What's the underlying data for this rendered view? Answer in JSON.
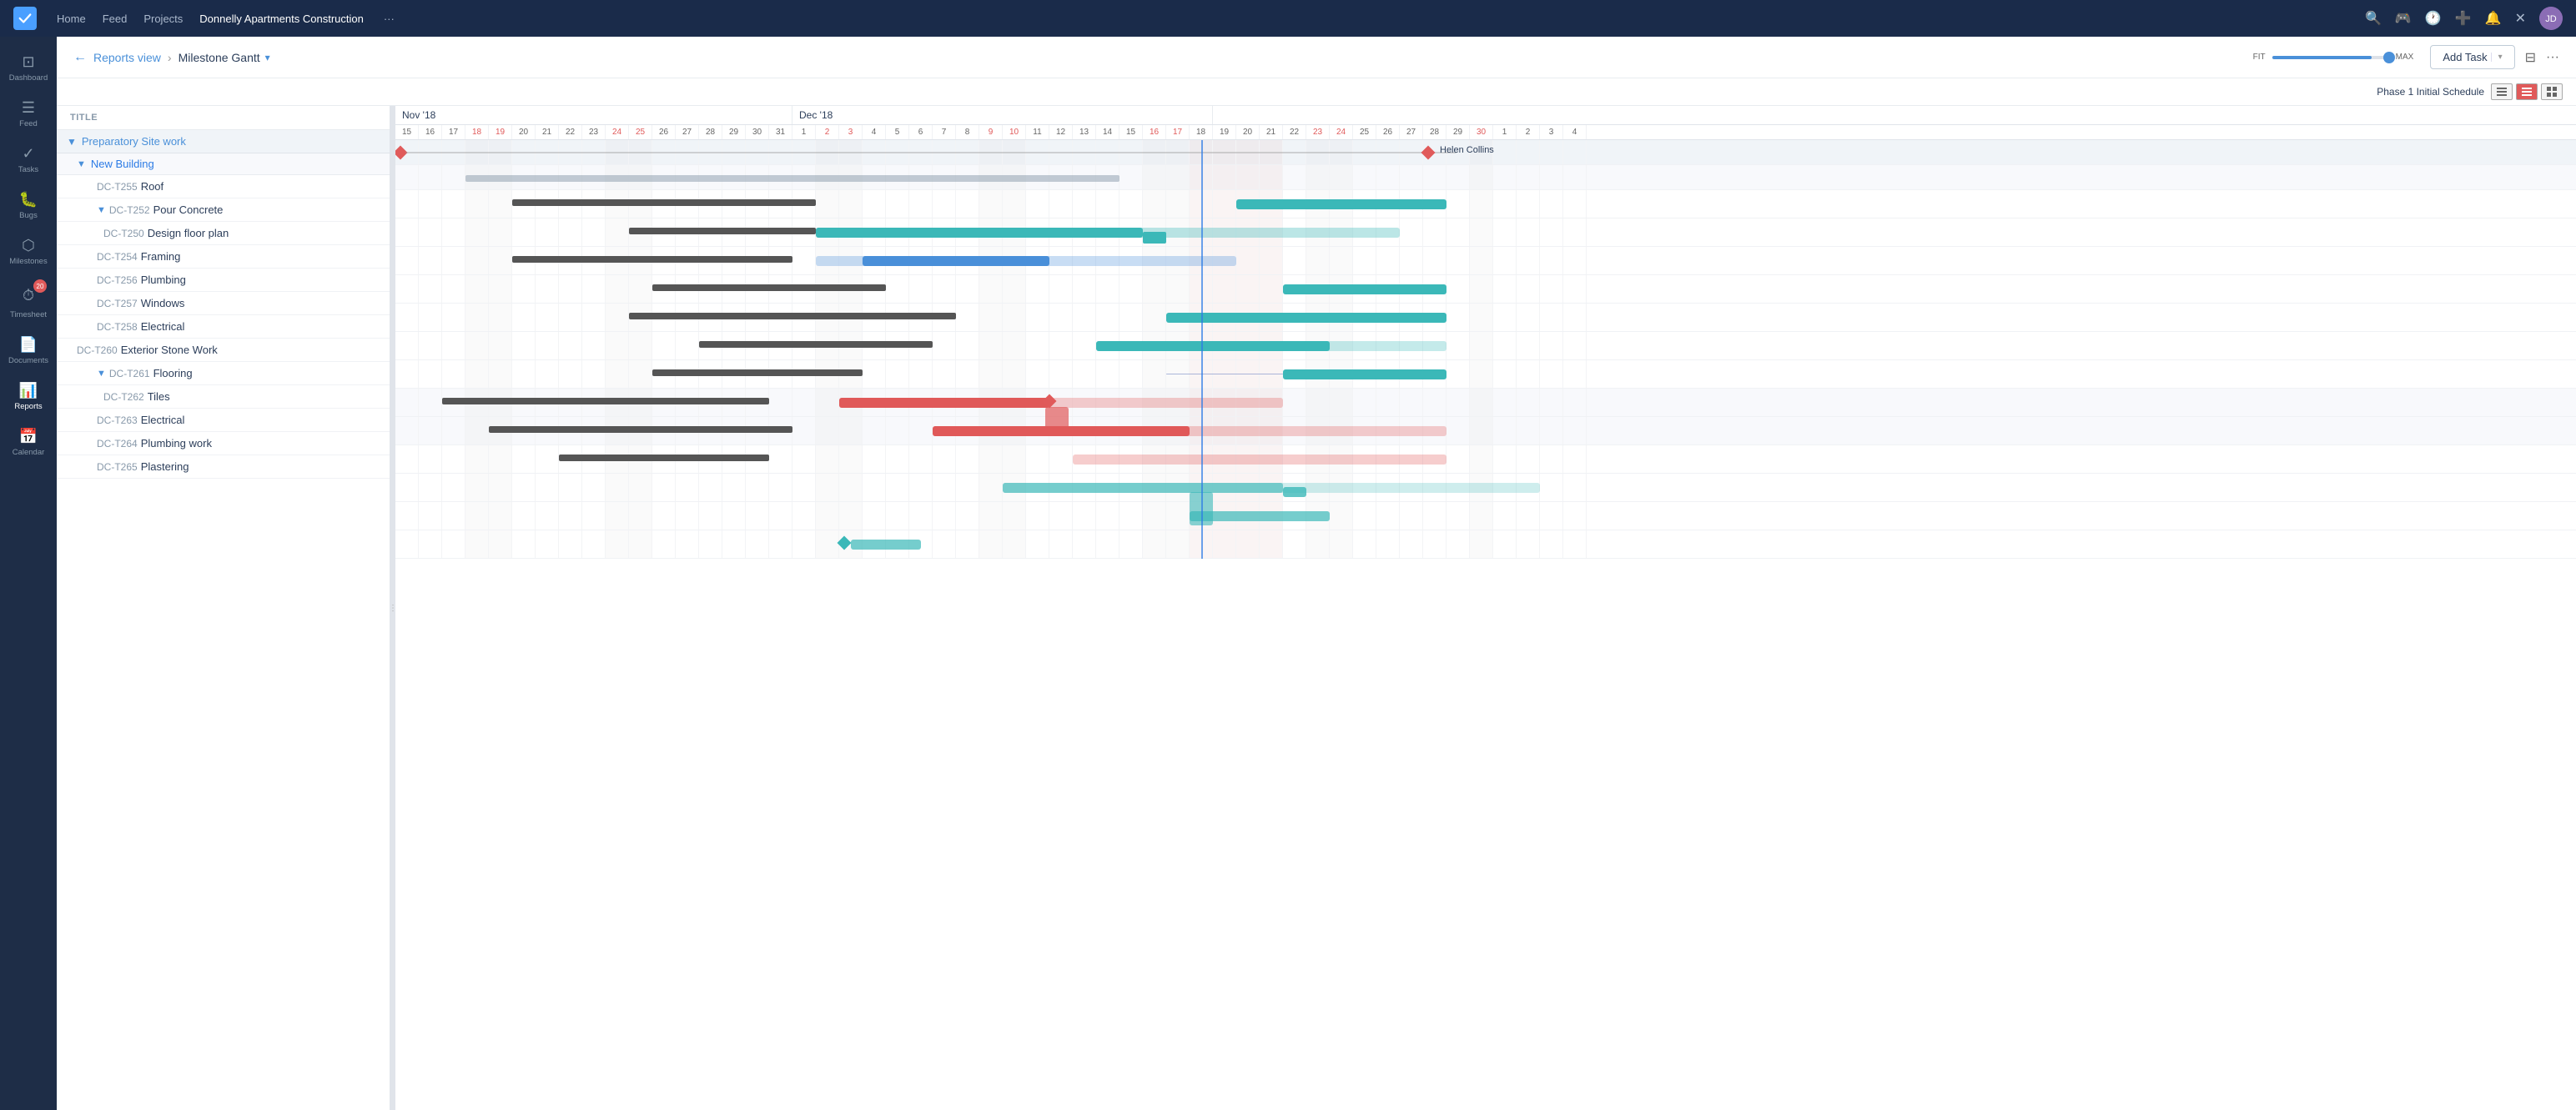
{
  "app": {
    "logo_text": "✓",
    "nav_links": [
      "Home",
      "Feed",
      "Projects"
    ],
    "project_name": "Donnelly Apartments Construction",
    "more_dots": "···"
  },
  "nav_right": {
    "search_icon": "🔍",
    "gamepad_icon": "🎮",
    "clock_icon": "🕐",
    "plus_icon": "➕",
    "bell_icon": "🔔",
    "close_icon": "✕"
  },
  "sidebar": {
    "items": [
      {
        "id": "dashboard",
        "label": "Dashboard",
        "icon": "⊡"
      },
      {
        "id": "feed",
        "label": "Feed",
        "icon": "☰"
      },
      {
        "id": "tasks",
        "label": "Tasks",
        "icon": "✓"
      },
      {
        "id": "bugs",
        "label": "Bugs",
        "icon": "🐛"
      },
      {
        "id": "milestones",
        "label": "Milestones",
        "icon": "⬡"
      },
      {
        "id": "timesheet",
        "label": "Timesheet",
        "icon": "⏱",
        "badge": "20"
      },
      {
        "id": "documents",
        "label": "Documents",
        "icon": "📄"
      },
      {
        "id": "reports",
        "label": "Reports",
        "icon": "📊",
        "active": true
      },
      {
        "id": "calendar",
        "label": "Calendar",
        "icon": "📅"
      }
    ]
  },
  "header": {
    "back_label": "←",
    "breadcrumb": "Reports view",
    "breadcrumb_sep": "›",
    "view_title": "Milestone Gantt",
    "dropdown_arrow": "▾",
    "fit_label": "FIT",
    "max_label": "MAX",
    "add_task_label": "Add Task",
    "filter_icon": "⊟",
    "more_icon": "···",
    "phase_label": "Phase 1 Initial Schedule"
  },
  "months": [
    {
      "label": "Nov '18",
      "span": 17
    },
    {
      "label": "Dec '18",
      "span": 18
    }
  ],
  "days": [
    {
      "d": "15",
      "w": false
    },
    {
      "d": "16",
      "w": false
    },
    {
      "d": "17",
      "w": false
    },
    {
      "d": "18",
      "w": true
    },
    {
      "d": "19",
      "w": true
    },
    {
      "d": "20",
      "w": false
    },
    {
      "d": "21",
      "w": false
    },
    {
      "d": "22",
      "w": false
    },
    {
      "d": "23",
      "w": false
    },
    {
      "d": "24",
      "w": true
    },
    {
      "d": "25",
      "w": true
    },
    {
      "d": "26",
      "w": false
    },
    {
      "d": "27",
      "w": false
    },
    {
      "d": "28",
      "w": false
    },
    {
      "d": "29",
      "w": false
    },
    {
      "d": "30",
      "w": false
    },
    {
      "d": "31",
      "w": false
    },
    {
      "d": "1",
      "w": false
    },
    {
      "d": "2",
      "w": true
    },
    {
      "d": "3",
      "w": true
    },
    {
      "d": "4",
      "w": false
    },
    {
      "d": "5",
      "w": false
    },
    {
      "d": "6",
      "w": false
    },
    {
      "d": "7",
      "w": false
    },
    {
      "d": "8",
      "w": false
    },
    {
      "d": "9",
      "w": true
    },
    {
      "d": "10",
      "w": true
    },
    {
      "d": "11",
      "w": false
    },
    {
      "d": "12",
      "w": false
    },
    {
      "d": "13",
      "w": false
    },
    {
      "d": "14",
      "w": false
    },
    {
      "d": "15",
      "w": false
    },
    {
      "d": "16",
      "w": true
    },
    {
      "d": "17",
      "w": true
    },
    {
      "d": "18",
      "w": false
    },
    {
      "d": "19",
      "w": false
    },
    {
      "d": "20",
      "w": false
    },
    {
      "d": "21",
      "w": false
    },
    {
      "d": "22",
      "w": false
    },
    {
      "d": "23",
      "w": true
    },
    {
      "d": "24",
      "w": true
    },
    {
      "d": "25",
      "w": false
    },
    {
      "d": "26",
      "w": false
    },
    {
      "d": "27",
      "w": false
    },
    {
      "d": "28",
      "w": false
    },
    {
      "d": "29",
      "w": false
    },
    {
      "d": "30",
      "w": true
    },
    {
      "d": "1",
      "w": false
    },
    {
      "d": "2",
      "w": false
    },
    {
      "d": "3",
      "w": false
    },
    {
      "d": "4",
      "w": false
    }
  ],
  "tasks": [
    {
      "id": "phase",
      "indent": 0,
      "type": "phase",
      "label": "Preparatory Site work",
      "toggle": true
    },
    {
      "id": "group1",
      "indent": 1,
      "type": "group",
      "code": "",
      "label": "New Building",
      "toggle": true
    },
    {
      "id": "t255",
      "indent": 2,
      "type": "task",
      "code": "DC-T255",
      "label": "Roof"
    },
    {
      "id": "t252",
      "indent": 2,
      "type": "group",
      "code": "DC-T252",
      "label": "Pour Concrete",
      "toggle": true
    },
    {
      "id": "t250",
      "indent": 3,
      "type": "task",
      "code": "DC-T250",
      "label": "Design floor plan"
    },
    {
      "id": "t254",
      "indent": 2,
      "type": "task",
      "code": "DC-T254",
      "label": "Framing"
    },
    {
      "id": "t256",
      "indent": 2,
      "type": "task",
      "code": "DC-T256",
      "label": "Plumbing"
    },
    {
      "id": "t257",
      "indent": 2,
      "type": "task",
      "code": "DC-T257",
      "label": "Windows"
    },
    {
      "id": "t258",
      "indent": 2,
      "type": "task",
      "code": "DC-T258",
      "label": "Electrical"
    },
    {
      "id": "t260",
      "indent": 1,
      "type": "task",
      "code": "DC-T260",
      "label": "Exterior Stone Work"
    },
    {
      "id": "t261",
      "indent": 2,
      "type": "group",
      "code": "DC-T261",
      "label": "Flooring",
      "toggle": true
    },
    {
      "id": "t262",
      "indent": 3,
      "type": "task",
      "code": "DC-T262",
      "label": "Tiles"
    },
    {
      "id": "t263",
      "indent": 2,
      "type": "task",
      "code": "DC-T263",
      "label": "Electrical"
    },
    {
      "id": "t264",
      "indent": 2,
      "type": "task",
      "code": "DC-T264",
      "label": "Plumbing work"
    },
    {
      "id": "t265",
      "indent": 2,
      "type": "task",
      "code": "DC-T265",
      "label": "Plastering"
    }
  ],
  "milestone_label": "Helen Collins"
}
